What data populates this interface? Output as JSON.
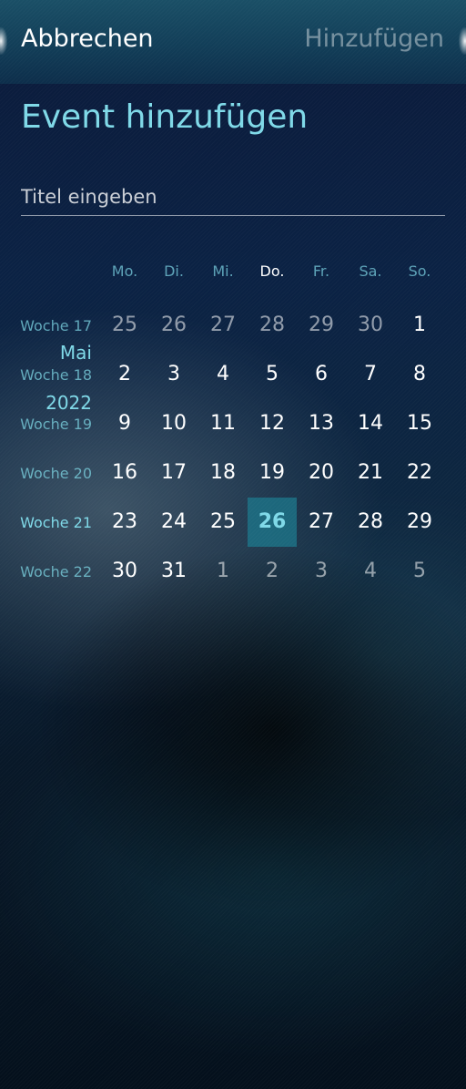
{
  "header": {
    "cancel_label": "Abbrechen",
    "add_label": "Hinzufügen"
  },
  "page_title": "Event hinzufügen",
  "title_field": {
    "placeholder": "Titel eingeben",
    "value": ""
  },
  "calendar": {
    "month_label": "Mai",
    "year_label": "2022",
    "weekdays": [
      "Mo.",
      "Di.",
      "Mi.",
      "Do.",
      "Fr.",
      "Sa.",
      "So."
    ],
    "today_weekday": "Do.",
    "selected_day": "26",
    "weeks": [
      {
        "label": "Woche 17",
        "days": [
          "25",
          "26",
          "27",
          "28",
          "29",
          "30",
          "1"
        ]
      },
      {
        "label": "Woche 18",
        "days": [
          "2",
          "3",
          "4",
          "5",
          "6",
          "7",
          "8"
        ]
      },
      {
        "label": "Woche 19",
        "days": [
          "9",
          "10",
          "11",
          "12",
          "13",
          "14",
          "15"
        ]
      },
      {
        "label": "Woche 20",
        "days": [
          "16",
          "17",
          "18",
          "19",
          "20",
          "21",
          "22"
        ]
      },
      {
        "label": "Woche 21",
        "days": [
          "23",
          "24",
          "25",
          "26",
          "27",
          "28",
          "29"
        ]
      },
      {
        "label": "Woche 22",
        "days": [
          "30",
          "31",
          "1",
          "2",
          "3",
          "4",
          "5"
        ]
      }
    ]
  },
  "colors": {
    "accent": "#7fd9e8",
    "selected_bg": "#1c788c",
    "header_bg": "#123e58"
  }
}
